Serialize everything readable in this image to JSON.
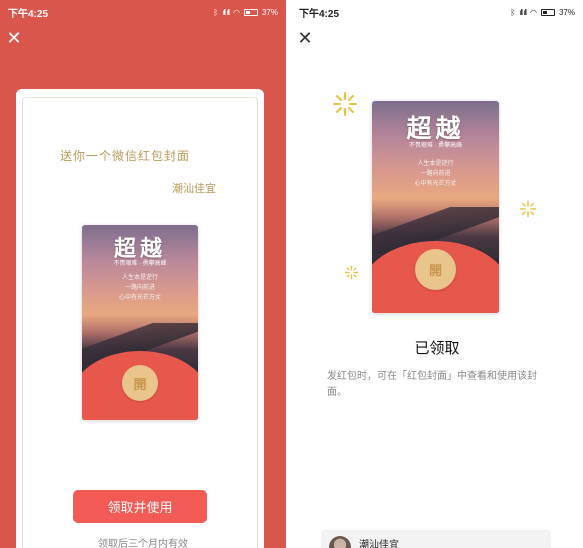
{
  "status_bar": {
    "time": "下午4:25",
    "signal_text": "ıll ıll",
    "battery": "37%"
  },
  "colors": {
    "brand_red": "#d9564c",
    "button_red": "#f25a55",
    "gold": "#b89a5a",
    "coin": "#e9c48b"
  },
  "left_screen": {
    "close_icon": "✕",
    "gift_title": "送你一个微信红包封面",
    "sender_name": "潮汕佳宜",
    "cover": {
      "brand": "超越",
      "subtitle": "不畏艰难 · 勇攀高峰",
      "poem_lines": [
        "人生本是逆行",
        "一路向前进",
        "心中有光芒万丈"
      ],
      "open_char": "開"
    },
    "claim_button": "领取并使用",
    "validity_note": "领取后三个月内有效"
  },
  "right_screen": {
    "close_icon": "✕",
    "cover": {
      "brand": "超越",
      "subtitle": "不畏艰难 · 勇攀高峰",
      "poem_lines": [
        "人生本是逆行",
        "一路向前进",
        "心中有光芒万丈"
      ],
      "open_char": "開"
    },
    "status_title": "已领取",
    "description": "发红包时，可在「红包封面」中查看和使用该封面。",
    "sender_card": {
      "name": "潮汕佳宜"
    }
  }
}
